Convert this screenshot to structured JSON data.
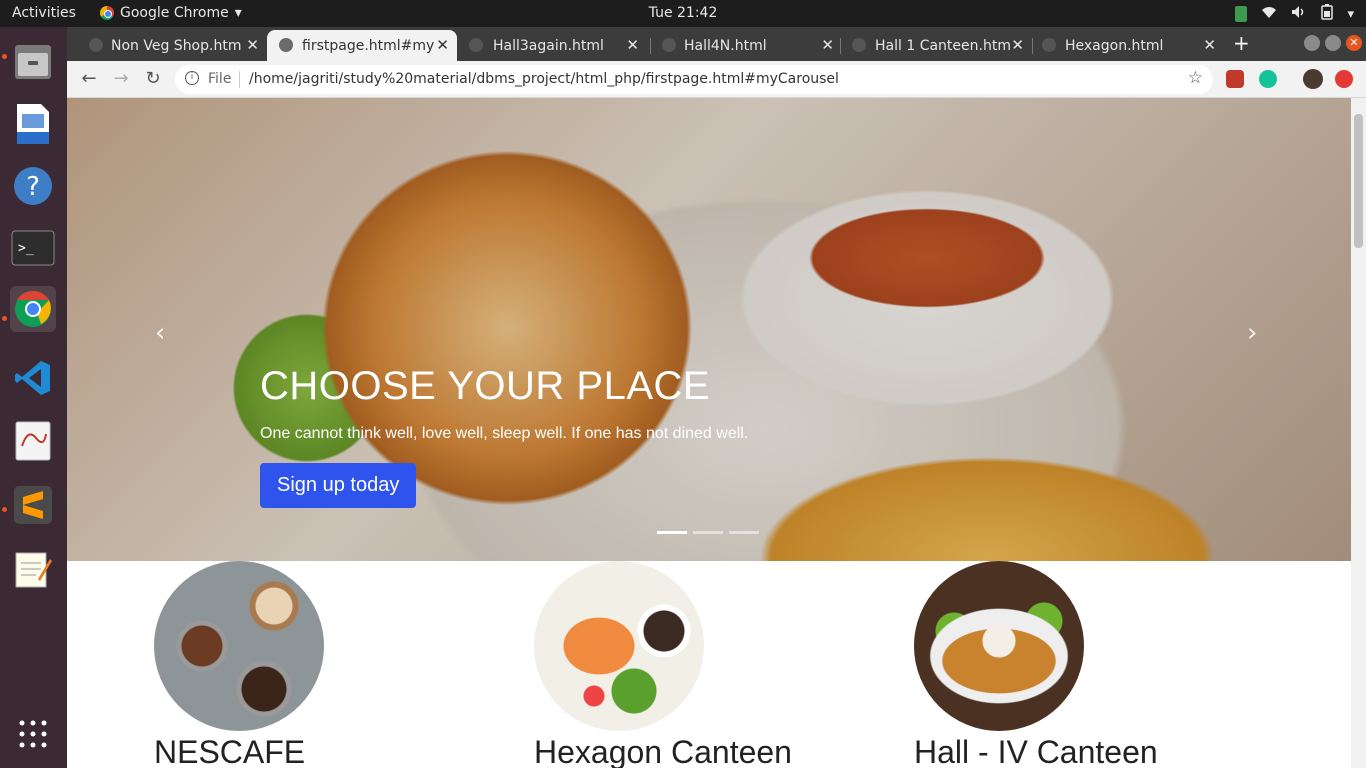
{
  "topbar": {
    "activities": "Activities",
    "app_name": "Google Chrome",
    "clock": "Tue 21:42"
  },
  "tabs": [
    {
      "title": "Non Veg Shop.htm",
      "active": false
    },
    {
      "title": "firstpage.html#my",
      "active": true
    },
    {
      "title": "Hall3again.html",
      "active": false
    },
    {
      "title": "Hall4N.html",
      "active": false
    },
    {
      "title": "Hall 1 Canteen.htm",
      "active": false
    },
    {
      "title": "Hexagon.html",
      "active": false
    }
  ],
  "omnibox": {
    "scheme_label": "File",
    "url": "/home/jagriti/study%20material/dbms_project/html_php/firstpage.html#myCarousel"
  },
  "carousel": {
    "heading": "CHOOSE YOUR PLACE",
    "tagline": "One cannot think well, love well, sleep well. If one has not dined well.",
    "cta": "Sign up today",
    "slide_count": 3,
    "active_slide": 1
  },
  "cards": [
    {
      "title": "NESCAFE"
    },
    {
      "title": "Hexagon Canteen"
    },
    {
      "title": "Hall - IV Canteen"
    }
  ],
  "dock": {
    "icons": [
      "files-icon",
      "writer-icon",
      "help-icon",
      "terminal-icon",
      "chrome-icon",
      "vscode-icon",
      "document-viewer-icon",
      "sublime-icon",
      "text-editor-icon",
      "app-grid-icon"
    ]
  }
}
